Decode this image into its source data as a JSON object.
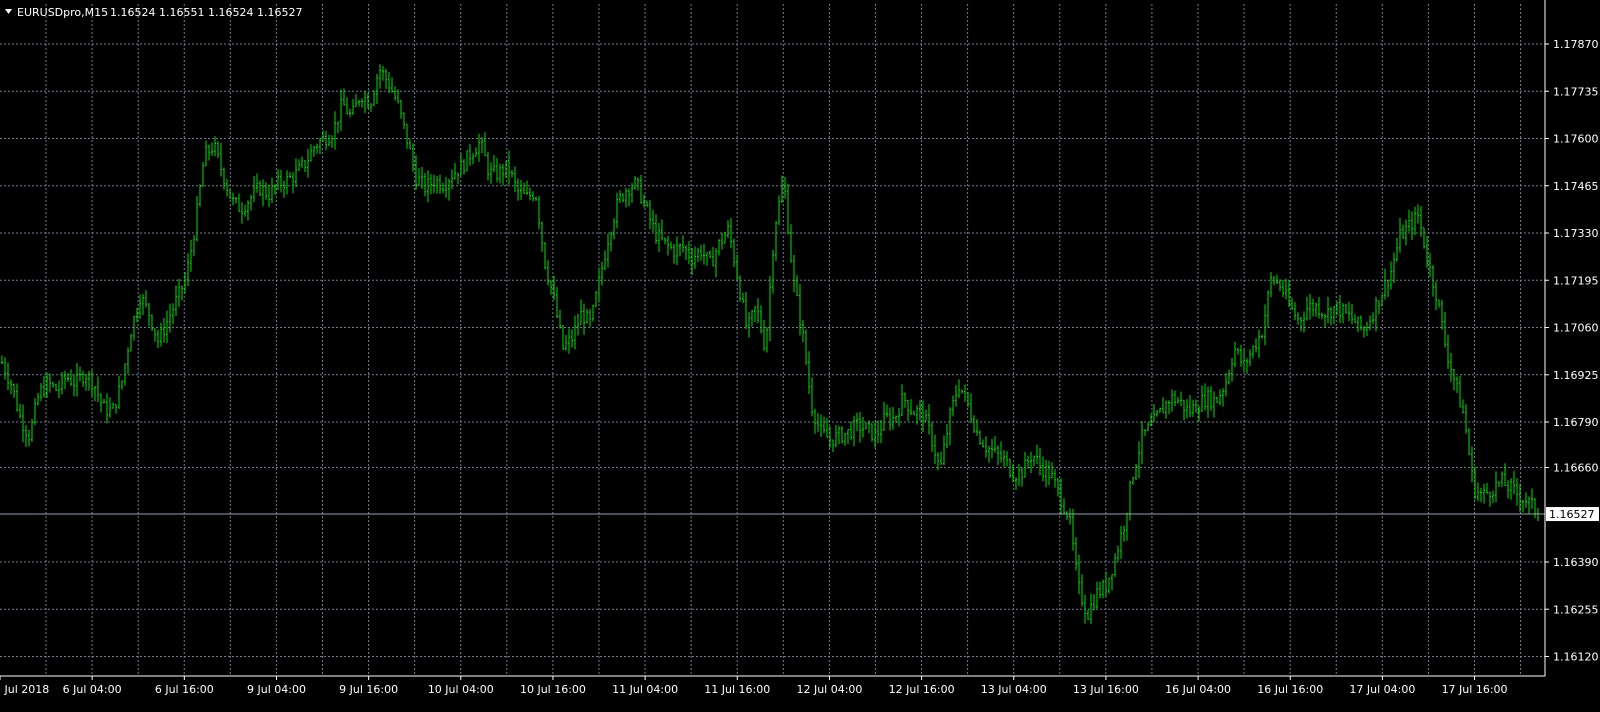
{
  "header": {
    "symbol": "EURUSDpro,M15",
    "ohlc": "1.16524 1.16551 1.16524 1.16527",
    "collapse_icon": "triangle-down-icon"
  },
  "colors": {
    "background": "#000000",
    "grid": "#6f7f92",
    "bars": "#00e000",
    "axis_text": "#ffffff",
    "price_line": "#8fa0b2",
    "price_tag_bg": "#ffffff",
    "price_tag_text": "#000000"
  },
  "chart_data": {
    "type": "bar",
    "grid": true,
    "ylim": [
      1.1606,
      1.1793
    ],
    "y_ticks": [
      "1.17870",
      "1.17735",
      "1.17600",
      "1.17465",
      "1.17330",
      "1.17195",
      "1.17060",
      "1.16925",
      "1.16790",
      "1.16660",
      "1.16390",
      "1.16255",
      "1.16120"
    ],
    "x_ticks": [
      "5 Jul 2018",
      "6 Jul 04:00",
      "6 Jul 16:00",
      "9 Jul 04:00",
      "9 Jul 16:00",
      "10 Jul 04:00",
      "10 Jul 16:00",
      "11 Jul 04:00",
      "11 Jul 16:00",
      "12 Jul 04:00",
      "12 Jul 16:00",
      "13 Jul 04:00",
      "13 Jul 16:00",
      "16 Jul 04:00",
      "16 Jul 16:00",
      "17 Jul 04:00",
      "17 Jul 16:00"
    ],
    "current_price": "1.16527",
    "series": [
      {
        "values": [
          1.1696,
          1.169,
          1.168,
          1.1675,
          1.1687,
          1.169,
          1.1688,
          1.1692,
          1.169,
          1.1693,
          1.169,
          1.1683,
          1.1682,
          1.169,
          1.1705,
          1.1715,
          1.171,
          1.1702,
          1.1708,
          1.1714,
          1.172,
          1.1735,
          1.1755,
          1.1758,
          1.175,
          1.1742,
          1.174,
          1.1743,
          1.1746,
          1.1744,
          1.1747,
          1.1748,
          1.175,
          1.1753,
          1.1758,
          1.176,
          1.1762,
          1.177,
          1.1766,
          1.1773,
          1.177,
          1.178,
          1.1776,
          1.177,
          1.176,
          1.1749,
          1.1746,
          1.1748,
          1.1747,
          1.175,
          1.1752,
          1.1756,
          1.1759,
          1.175,
          1.175,
          1.1752,
          1.1745,
          1.1743,
          1.1745,
          1.1725,
          1.1714,
          1.17,
          1.1703,
          1.171,
          1.1707,
          1.172,
          1.1733,
          1.1742,
          1.1746,
          1.1747,
          1.174,
          1.1733,
          1.173,
          1.1728,
          1.1729,
          1.1726,
          1.1728,
          1.1724,
          1.173,
          1.1734,
          1.172,
          1.1705,
          1.1712,
          1.17,
          1.1735,
          1.1748,
          1.172,
          1.1705,
          1.1684,
          1.1676,
          1.1674,
          1.1675,
          1.1676,
          1.1678,
          1.1677,
          1.1675,
          1.168,
          1.168,
          1.1686,
          1.1682,
          1.1682,
          1.1675,
          1.1665,
          1.168,
          1.169,
          1.1684,
          1.1676,
          1.1672,
          1.167,
          1.1668,
          1.1664,
          1.1665,
          1.167,
          1.1666,
          1.1664,
          1.1658,
          1.1652,
          1.1632,
          1.1624,
          1.163,
          1.1632,
          1.164,
          1.165,
          1.1665,
          1.1675,
          1.1678,
          1.1682,
          1.1686,
          1.1685,
          1.1682,
          1.1684,
          1.1686,
          1.1685,
          1.169,
          1.17,
          1.1695,
          1.17,
          1.1705,
          1.172,
          1.1718,
          1.1712,
          1.1708,
          1.1712,
          1.1712,
          1.171,
          1.1712,
          1.171,
          1.1708,
          1.1705,
          1.171,
          1.1716,
          1.1722,
          1.1732,
          1.1735,
          1.1738,
          1.1725,
          1.1715,
          1.17,
          1.169,
          1.168,
          1.166,
          1.1658,
          1.166,
          1.1662,
          1.166,
          1.1658,
          1.1656,
          1.1653
        ]
      }
    ]
  }
}
